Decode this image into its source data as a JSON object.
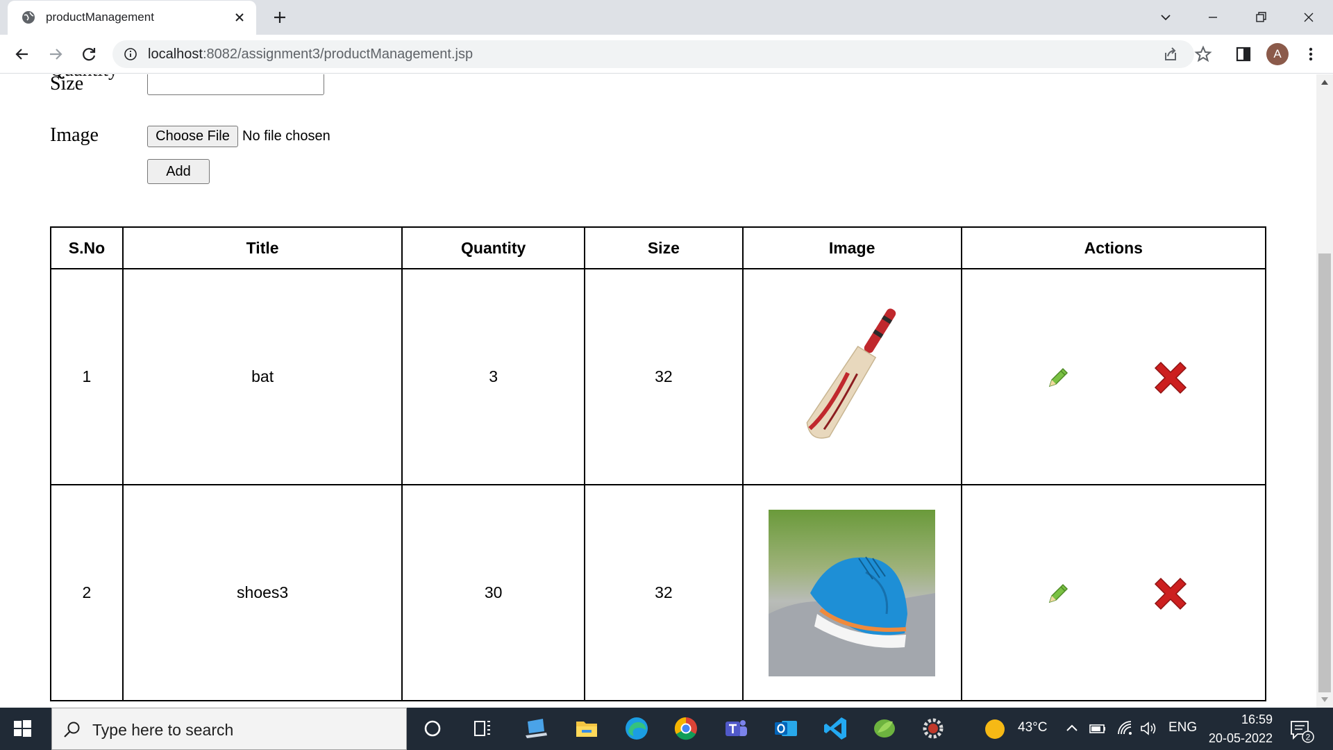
{
  "browser": {
    "tab_title": "productManagement",
    "url_host": "localhost",
    "url_path": ":8082/assignment3/productManagement.jsp",
    "avatar_letter": "A"
  },
  "form": {
    "partial_label": "Quantity",
    "size_label": "Size",
    "size_value": "",
    "image_label": "Image",
    "choose_file_label": "Choose File",
    "file_status": "No file chosen",
    "add_label": "Add"
  },
  "table": {
    "headers": [
      "S.No",
      "Title",
      "Quantity",
      "Size",
      "Image",
      "Actions"
    ],
    "rows": [
      {
        "sno": "1",
        "title": "bat",
        "quantity": "3",
        "size": "32",
        "image": "cricket-bat-image"
      },
      {
        "sno": "2",
        "title": "shoes3",
        "quantity": "30",
        "size": "32",
        "image": "blue-sneakers-image"
      }
    ]
  },
  "taskbar": {
    "search_placeholder": "Type here to search",
    "temperature": "43°C",
    "language": "ENG",
    "time": "16:59",
    "date": "20-05-2022",
    "notification_count": "2"
  },
  "colors": {
    "edit": "#7ac143",
    "delete": "#cc1f1f",
    "taskbar": "#202a36"
  }
}
